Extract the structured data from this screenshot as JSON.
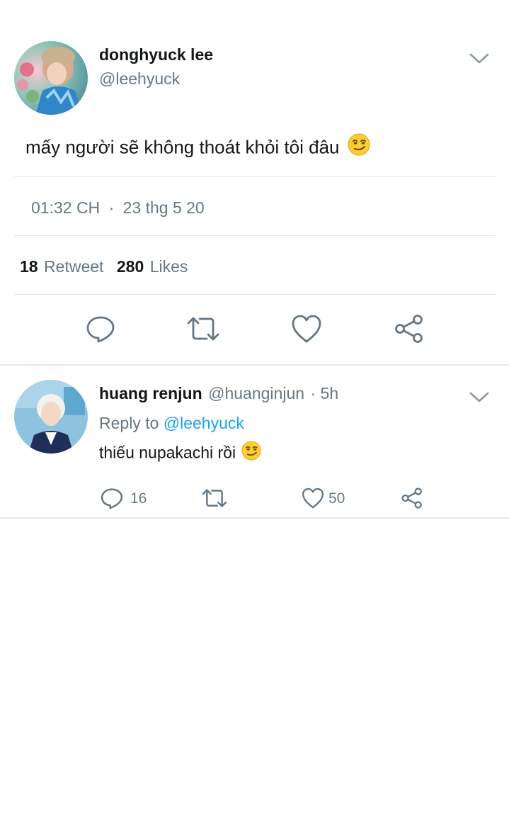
{
  "main_tweet": {
    "author_name": "donghyuck lee",
    "author_handle": "@leehyuck",
    "text": "mấy người sẽ không thoát khỏi tôi đâu",
    "emoji": "smirk",
    "time": "01:32 CH",
    "separator": "·",
    "date": "23 thg 5 20",
    "retweet_count": "18",
    "retweet_label": "Retweet",
    "like_count": "280",
    "like_label": "Likes",
    "actions": [
      "reply-icon",
      "retweet-icon",
      "like-icon",
      "share-icon"
    ]
  },
  "reply": {
    "author_name": "huang renjun",
    "author_handle": "@huanginjun",
    "time_ago": "· 5h",
    "reply_to_label": "Reply to",
    "reply_to_handle": "@leehyuck",
    "text": "thiếu nupakachi rồi",
    "reply_count": "16",
    "like_count": "50"
  },
  "colors": {
    "text": "#14171a",
    "muted": "#657786",
    "link": "#1da1f2",
    "divider": "#e1e8ed",
    "icon": "#657786"
  }
}
